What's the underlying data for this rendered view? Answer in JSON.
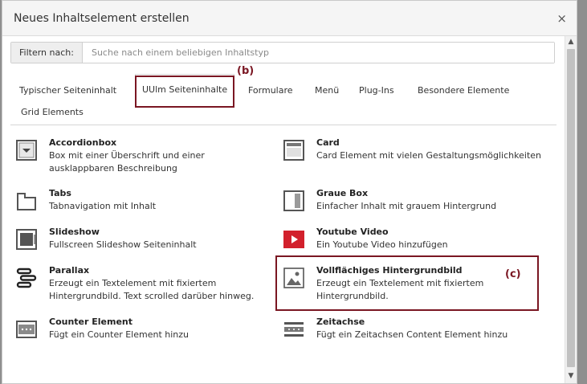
{
  "dialog": {
    "title": "Neues Inhaltselement erstellen",
    "close_symbol": "×"
  },
  "filter": {
    "label": "Filtern nach:",
    "placeholder": "Suche nach einem beliebigen Inhaltstyp"
  },
  "tabs": [
    {
      "label": "Typischer Seiteninhalt",
      "active": false
    },
    {
      "label": "UUlm Seiteninhalte",
      "active": true
    },
    {
      "label": "Formulare",
      "active": false
    },
    {
      "label": "Menü",
      "active": false
    },
    {
      "label": "Plug-Ins",
      "active": false
    },
    {
      "label": "Besondere Elemente",
      "active": false
    },
    {
      "label": "Grid Elements",
      "active": false
    }
  ],
  "annotations": {
    "b": "(b)",
    "c": "(c)",
    "color": "#7a1622"
  },
  "items": [
    {
      "title": "Accordionbox",
      "description": "Box mit einer Überschrift und einer ausklappbaren Beschreibung",
      "icon": "accordion-icon"
    },
    {
      "title": "Card",
      "description": "Card Element mit vielen Gestaltungsmöglichkeiten",
      "icon": "card-icon"
    },
    {
      "title": "Tabs",
      "description": "Tabnavigation mit Inhalt",
      "icon": "tabs-icon"
    },
    {
      "title": "Graue Box",
      "description": "Einfacher Inhalt mit grauem Hintergrund",
      "icon": "grey-box-icon"
    },
    {
      "title": "Slideshow",
      "description": "Fullscreen Slideshow Seiteninhalt",
      "icon": "slideshow-icon"
    },
    {
      "title": "Youtube Video",
      "description": "Ein Youtube Video hinzufügen",
      "icon": "youtube-icon"
    },
    {
      "title": "Parallax",
      "description": "Erzeugt ein Textelement mit fixiertem Hintergrundbild. Text scrolled darüber hinweg.",
      "icon": "parallax-icon"
    },
    {
      "title": "Vollflächiges Hintergrundbild",
      "description": "Erzeugt ein Textelement mit fixiertem Hintergrundbild.",
      "icon": "image-icon"
    },
    {
      "title": "Counter Element",
      "description": "Fügt ein Counter Element hinzu",
      "icon": "counter-icon"
    },
    {
      "title": "Zeitachse",
      "description": "Fügt ein Zeitachsen Content Element hinzu",
      "icon": "timeline-icon"
    }
  ],
  "colors": {
    "youtube_red": "#d2202c",
    "icon_gray": "#555555"
  }
}
